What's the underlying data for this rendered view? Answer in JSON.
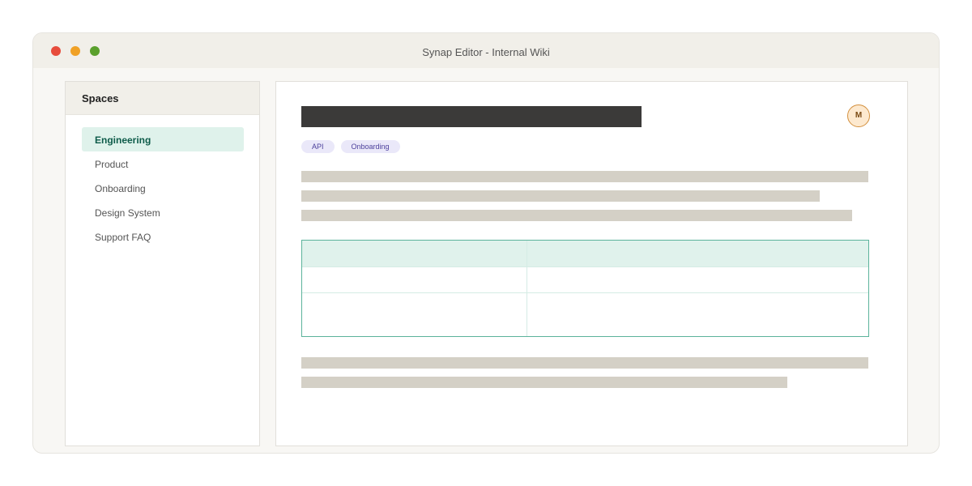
{
  "window": {
    "title": "Synap Editor - Internal Wiki",
    "traffic_lights": {
      "close_color": "#e74c3c",
      "minimize_color": "#f0a126",
      "zoom_color": "#5aa02c"
    }
  },
  "sidebar": {
    "title": "Spaces",
    "items": [
      {
        "label": "Engineering",
        "active": true
      },
      {
        "label": "Product",
        "active": false
      },
      {
        "label": "Onboarding",
        "active": false
      },
      {
        "label": "Design System",
        "active": false
      },
      {
        "label": "Support FAQ",
        "active": false
      }
    ]
  },
  "document": {
    "avatar_initial": "M",
    "tags": [
      "API",
      "Onboarding"
    ]
  },
  "colors": {
    "accent": "#0e5c4a",
    "accent_bg": "#dff2eb",
    "table_border": "#5bb39b",
    "tag_bg": "#eae8f9",
    "tag_text": "#4b3f9b",
    "avatar_border": "#d3903e"
  }
}
